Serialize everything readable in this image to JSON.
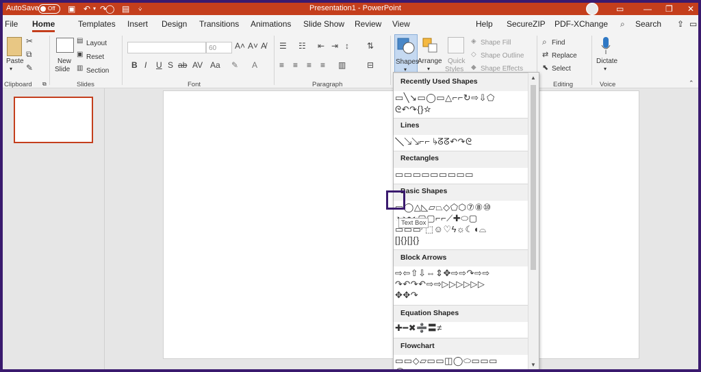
{
  "titlebar": {
    "autosave_label": "AutoSave",
    "autosave_state": "Off",
    "doc_title": "Presentation1 - PowerPoint",
    "icons": [
      "save-icon",
      "undo-icon",
      "redo-icon",
      "circle-icon",
      "present-icon",
      "customize-arrow-icon"
    ]
  },
  "tabs": [
    "File",
    "Home",
    "Templates",
    "Insert",
    "Design",
    "Transitions",
    "Animations",
    "Slide Show",
    "Review",
    "View",
    "Help",
    "SecureZIP",
    "PDF-XChange"
  ],
  "active_tab": "Home",
  "search_label": "Search",
  "ribbon": {
    "clipboard": {
      "paste": "Paste",
      "group": "Clipboard"
    },
    "slides": {
      "new_slide_1": "New",
      "new_slide_2": "Slide",
      "layout": "Layout",
      "reset": "Reset",
      "section": "Section",
      "group": "Slides"
    },
    "font": {
      "size": "60",
      "group": "Font",
      "buttons": [
        "B",
        "I",
        "U",
        "S",
        "ab",
        "AV",
        "Aa"
      ]
    },
    "paragraph": {
      "group": "Paragraph"
    },
    "drawing": {
      "shapes": "Shapes",
      "arrange": "Arrange",
      "quick_styles_1": "Quick",
      "quick_styles_2": "Styles",
      "shape_fill": "Shape Fill",
      "shape_outline": "Shape Outline",
      "shape_effects": "Shape Effects"
    },
    "editing": {
      "find": "Find",
      "replace": "Replace",
      "select": "Select",
      "group": "Editing"
    },
    "voice": {
      "dictate": "Dictate",
      "group": "Voice"
    }
  },
  "shapes_gallery": {
    "sections": [
      {
        "title": "Recently Used Shapes",
        "rows": [
          "▭╲↘▭◯▭△⌐⌐↻⇨⇩⬠",
          "ᘓ↶↷{}☆"
        ]
      },
      {
        "title": "Lines",
        "rows": [
          "╲↘↘⌐⌐↳ᘔᘔ↶↷ᘓ"
        ]
      },
      {
        "title": "Rectangles",
        "rows": [
          "▭▭▭▭▭▭▭▭▭"
        ]
      },
      {
        "title": "Basic Shapes",
        "rows": [
          "▭◯△◺▱⏢◇⬠⬡⑦⑧⑩",
          "◔◑◓◐▢▢⌐⌐⟋✚⬭▢",
          "▭▭▭◜⬚☺♡ϟ☼☾◖⌓",
          "[]{}[]{}"
        ]
      },
      {
        "title": "Block Arrows",
        "rows": [
          "⇨⇦⇧⇩⇔⇕✥⇨⇨↷⇨⇨",
          "↷↶↷↶⇨⇨▷▷▷▷▷▷",
          "✥✥↷"
        ]
      },
      {
        "title": "Equation Shapes",
        "rows": [
          "✚━✖➗〓≠"
        ]
      },
      {
        "title": "Flowchart",
        "rows": [
          "▭▭◇▱▭▭◫◯⬭▭▭▭",
          "◯▭◻▭▭◻◻▭▭▭▭▭"
        ]
      }
    ]
  },
  "tooltip": "Text Box"
}
